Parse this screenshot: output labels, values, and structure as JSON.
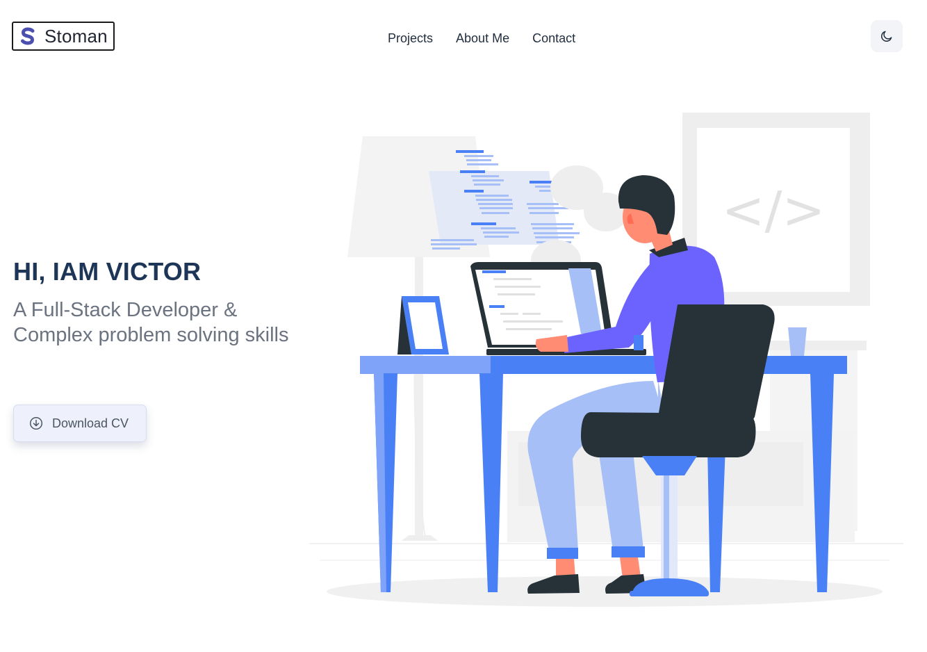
{
  "header": {
    "logo_letter": "S",
    "logo_text": "Stoman",
    "nav": [
      {
        "label": "Projects"
      },
      {
        "label": "About Me"
      },
      {
        "label": "Contact"
      }
    ],
    "theme_icon": "moon-icon"
  },
  "hero": {
    "title": "HI, IAM VICTOR",
    "subtitle": "A Full-Stack Developer & Complex problem solving skills",
    "cv_button_label": "Download CV",
    "cv_button_icon": "download-circle-icon"
  },
  "illustration": {
    "code_tag": "</>",
    "icon": "developer-at-desk-illustration"
  },
  "colors": {
    "heading": "#1d3557",
    "subtitle": "#6b7280",
    "logo_accent": "#4a4fb0",
    "desk_blue": "#4a80f5",
    "shirt_purple": "#6c63ff",
    "chair_dark": "#263238",
    "pants_light": "#a7bff7",
    "button_bg": "#eef1fb"
  }
}
